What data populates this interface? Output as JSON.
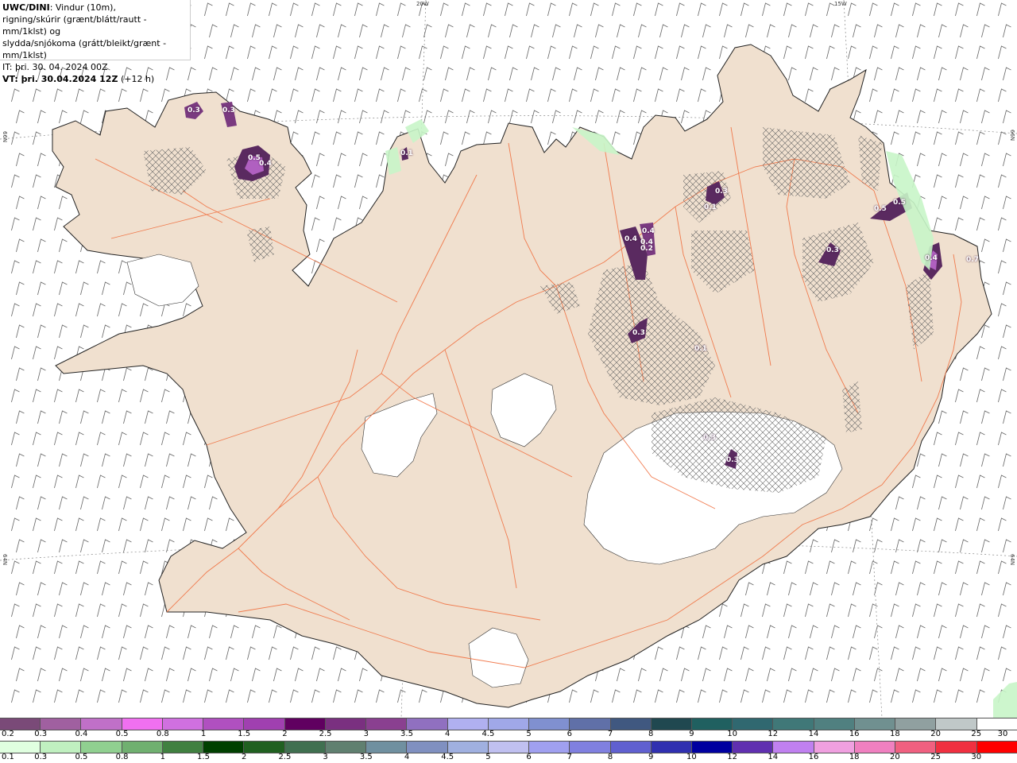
{
  "header": {
    "model": "UWC/DINI",
    "desc1": ": Vindur (10m),",
    "desc2": "rigning/skúrir (grænt/blátt/rautt - mm/1klst) og",
    "desc3": "slydda/snjókoma (grátt/bleikt/grænt - mm/1klst)",
    "it_line": "IT: þri. 30. 04. 2024 00Z",
    "vt_bold": "VT: þri. 30.04.2024 12Z",
    "vt_offset": "(+12 h)"
  },
  "map_axes": {
    "top_lon_1": "20W",
    "top_lon_2": "15W",
    "left_lat_1": "66N",
    "left_lat_2": "64N",
    "right_lat_1": "66N",
    "right_lat_2": "64N"
  },
  "precip_labels": [
    "0.3",
    "0.3",
    "0.5",
    "0.4",
    "0.4",
    "0.4",
    "0.4",
    "0.2",
    "0.3",
    "0.3",
    "0.1",
    "0.5",
    "0.5",
    "0.4",
    "0.3",
    "0.7",
    "0.3",
    "0.3",
    "0.1",
    "0.1"
  ],
  "colors": {
    "land": "#f0e0d0",
    "roads": "#f07040",
    "glacier": "#ffffff",
    "sea": "#ffffff",
    "precip_dark": "#5a2a60",
    "precip_mid": "#9a40b0",
    "precip_light": "#e080f0",
    "light_green": "#c8f5c8"
  },
  "legend_snow": {
    "ticks": [
      "0.2",
      "0.3",
      "0.4",
      "0.5",
      "0.8",
      "1",
      "1.5",
      "2",
      "2.5",
      "3",
      "3.5",
      "4",
      "4.5",
      "5",
      "6",
      "7",
      "8",
      "9",
      "10",
      "12",
      "14",
      "16",
      "18",
      "20",
      "25",
      "30"
    ],
    "colors": [
      "#7a4a78",
      "#a060a0",
      "#c070c8",
      "#f070f0",
      "#d070e0",
      "#b050c0",
      "#a040b0",
      "#600060",
      "#7a3080",
      "#8a4090",
      "#9070c0",
      "#b0b0f0",
      "#a0a8e8",
      "#8090d0",
      "#6070a8",
      "#405880",
      "#204850",
      "#206060",
      "#306870",
      "#407878",
      "#508080",
      "#709090",
      "#90a0a0",
      "#c0c8c8",
      "#ffffff"
    ]
  },
  "legend_rain": {
    "ticks": [
      "0.1",
      "0.3",
      "0.5",
      "0.8",
      "1",
      "1.5",
      "2",
      "2.5",
      "3",
      "3.5",
      "4",
      "4.5",
      "5",
      "6",
      "7",
      "8",
      "9",
      "10",
      "12",
      "14",
      "16",
      "18",
      "20",
      "25",
      "30"
    ],
    "colors": [
      "#e0ffe0",
      "#c0f0c0",
      "#90d090",
      "#70b070",
      "#408040",
      "#004000",
      "#206020",
      "#407050",
      "#608070",
      "#7090a0",
      "#8090c0",
      "#a0b0e0",
      "#c0c0f0",
      "#a0a0f0",
      "#8080e0",
      "#6060d0",
      "#3030b0",
      "#0000a0",
      "#6030b0",
      "#c080f0",
      "#f0a0e0",
      "#f080c0",
      "#f06080",
      "#f03040",
      "#ff0000"
    ]
  }
}
